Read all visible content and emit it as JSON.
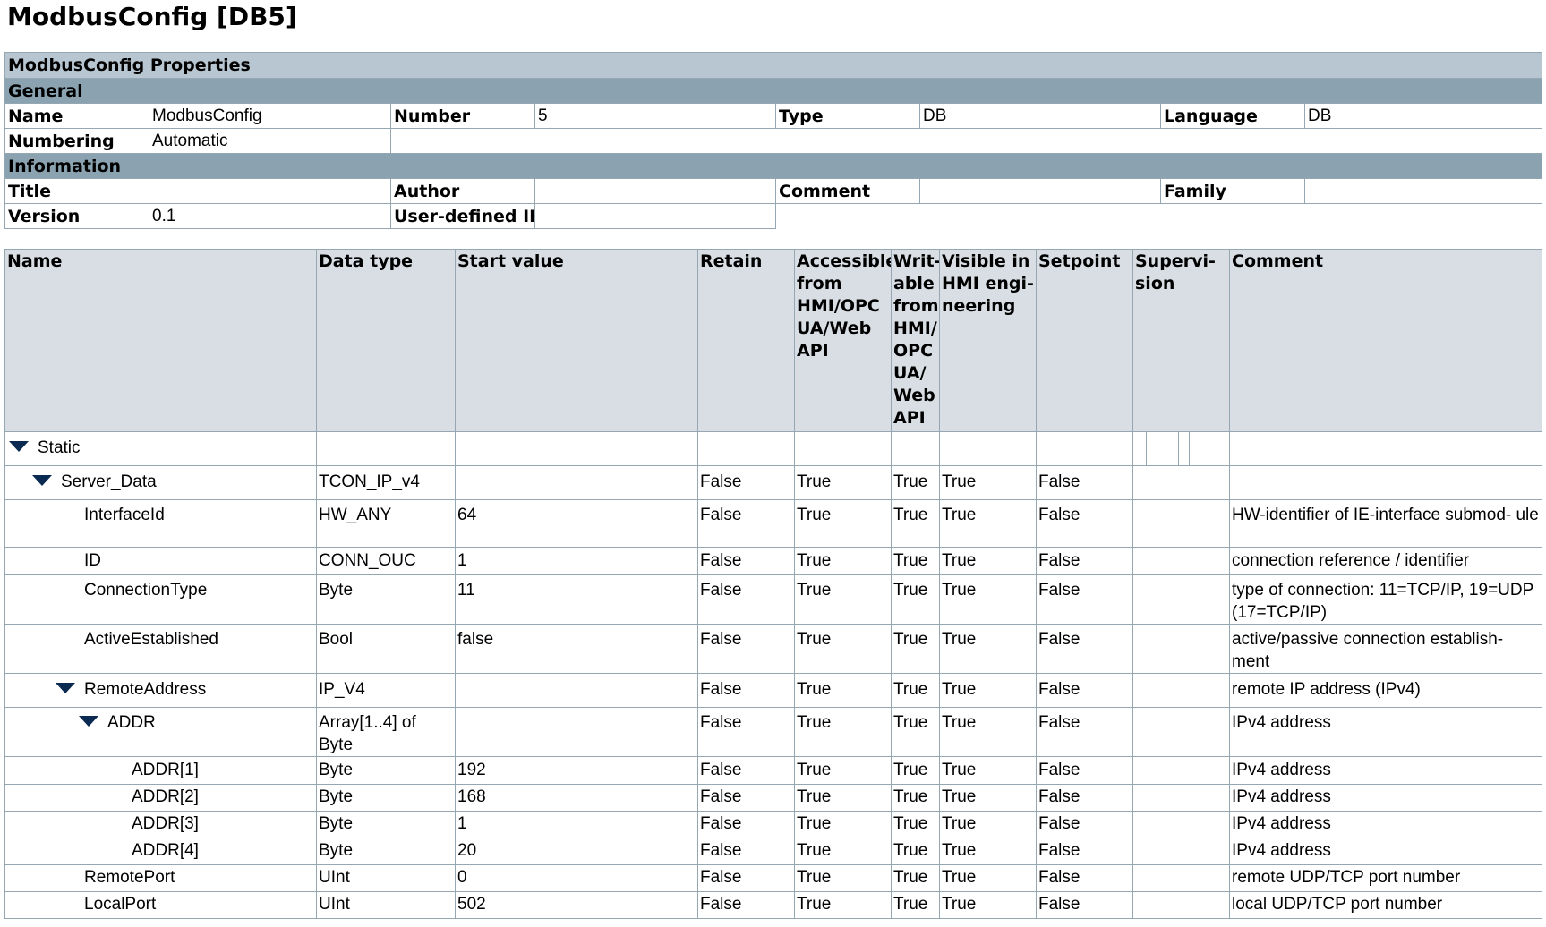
{
  "page_title": "ModbusConfig [DB5]",
  "properties": {
    "header": "ModbusConfig Properties",
    "general_label": "General",
    "name_label": "Name",
    "name_value": "ModbusConfig",
    "number_label": "Number",
    "number_value": "5",
    "type_label": "Type",
    "type_value": "DB",
    "language_label": "Language",
    "language_value": "DB",
    "numbering_label": "Numbering",
    "numbering_value": "Automatic",
    "information_label": "Information",
    "title_label": "Title",
    "title_value": "",
    "author_label": "Author",
    "author_value": "",
    "comment_label": "Comment",
    "comment_value": "",
    "family_label": "Family",
    "family_value": "",
    "version_label": "Version",
    "version_value": "0.1",
    "userid_label": "User-defined ID",
    "userid_value": ""
  },
  "table": {
    "columns": {
      "name": "Name",
      "data_type": "Data type",
      "start_value": "Start value",
      "retain": "Retain",
      "accessible": "Accessible from HMI/OPC UA/Web API",
      "writable": "Writ- able from HMI/ OPC UA/ Web API",
      "visible": "Visible in HMI engi- neering",
      "setpoint": "Setpoint",
      "supervision": "Supervi- sion",
      "comment": "Comment"
    },
    "rows": [
      {
        "name": "Static",
        "type": "",
        "start": "",
        "retain": "",
        "acc": "",
        "wr": "",
        "vis": "",
        "sp": "",
        "comment": ""
      },
      {
        "name": "Server_Data",
        "type": "TCON_IP_v4",
        "start": "",
        "retain": "False",
        "acc": "True",
        "wr": "True",
        "vis": "True",
        "sp": "False",
        "comment": ""
      },
      {
        "name": "InterfaceId",
        "type": "HW_ANY",
        "start": "64",
        "retain": "False",
        "acc": "True",
        "wr": "True",
        "vis": "True",
        "sp": "False",
        "comment": "HW-identifier of IE-interface submod- ule"
      },
      {
        "name": "ID",
        "type": "CONN_OUC",
        "start": "1",
        "retain": "False",
        "acc": "True",
        "wr": "True",
        "vis": "True",
        "sp": "False",
        "comment": "connection reference / identifier"
      },
      {
        "name": "ConnectionType",
        "type": "Byte",
        "start": "11",
        "retain": "False",
        "acc": "True",
        "wr": "True",
        "vis": "True",
        "sp": "False",
        "comment": "type of connection: 11=TCP/IP, 19=UDP (17=TCP/IP)"
      },
      {
        "name": "ActiveEstablished",
        "type": "Bool",
        "start": "false",
        "retain": "False",
        "acc": "True",
        "wr": "True",
        "vis": "True",
        "sp": "False",
        "comment": "active/passive connection establish- ment"
      },
      {
        "name": "RemoteAddress",
        "type": "IP_V4",
        "start": "",
        "retain": "False",
        "acc": "True",
        "wr": "True",
        "vis": "True",
        "sp": "False",
        "comment": "remote IP address (IPv4)"
      },
      {
        "name": "ADDR",
        "type": "Array[1..4] of Byte",
        "start": "",
        "retain": "False",
        "acc": "True",
        "wr": "True",
        "vis": "True",
        "sp": "False",
        "comment": "IPv4 address"
      },
      {
        "name": "ADDR[1]",
        "type": "Byte",
        "start": "192",
        "retain": "False",
        "acc": "True",
        "wr": "True",
        "vis": "True",
        "sp": "False",
        "comment": "IPv4 address"
      },
      {
        "name": "ADDR[2]",
        "type": "Byte",
        "start": "168",
        "retain": "False",
        "acc": "True",
        "wr": "True",
        "vis": "True",
        "sp": "False",
        "comment": "IPv4 address"
      },
      {
        "name": "ADDR[3]",
        "type": "Byte",
        "start": "1",
        "retain": "False",
        "acc": "True",
        "wr": "True",
        "vis": "True",
        "sp": "False",
        "comment": "IPv4 address"
      },
      {
        "name": "ADDR[4]",
        "type": "Byte",
        "start": "20",
        "retain": "False",
        "acc": "True",
        "wr": "True",
        "vis": "True",
        "sp": "False",
        "comment": "IPv4 address"
      },
      {
        "name": "RemotePort",
        "type": "UInt",
        "start": "0",
        "retain": "False",
        "acc": "True",
        "wr": "True",
        "vis": "True",
        "sp": "False",
        "comment": "remote UDP/TCP port number"
      },
      {
        "name": "LocalPort",
        "type": "UInt",
        "start": "502",
        "retain": "False",
        "acc": "True",
        "wr": "True",
        "vis": "True",
        "sp": "False",
        "comment": "local UDP/TCP port number"
      }
    ]
  }
}
